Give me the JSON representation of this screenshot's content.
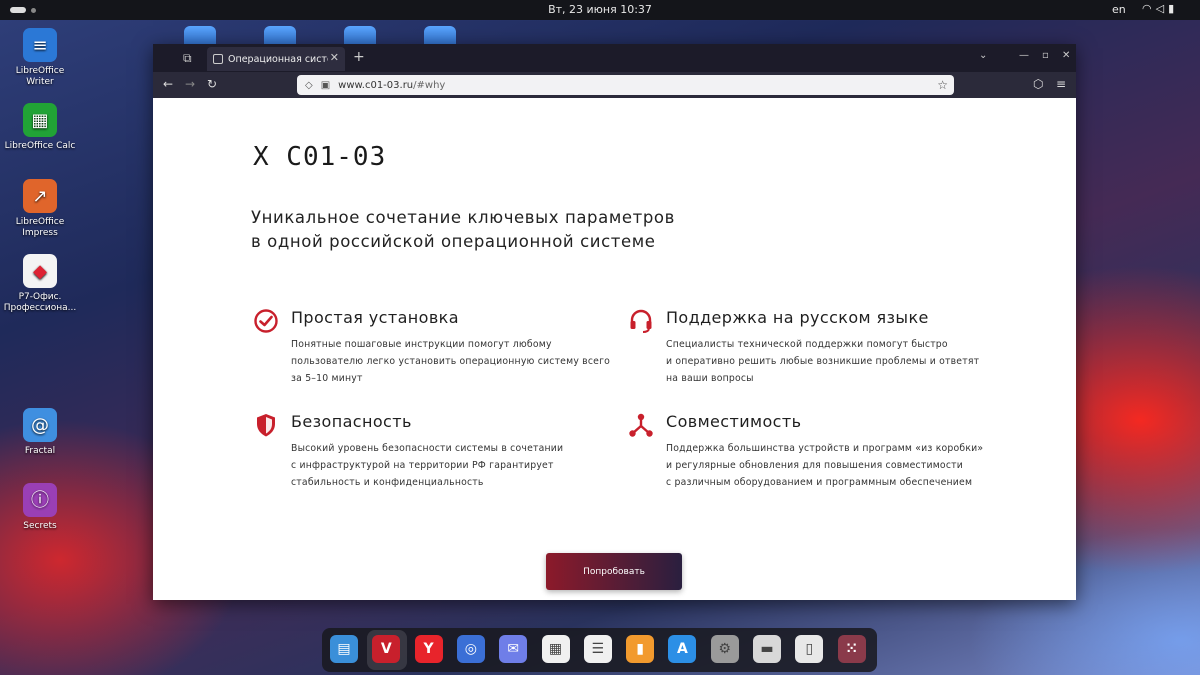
{
  "topbar": {
    "clock": "Вт, 23 июня  10:37",
    "language": "en"
  },
  "desktop": {
    "icons": [
      {
        "label_1": "LibreOffice",
        "label_2": "Writer",
        "icon": "writer-icon",
        "color": "#2b78d6"
      },
      {
        "label_1": "LibreOffice Calc",
        "label_2": "",
        "icon": "calc-icon",
        "color": "#21a336"
      },
      {
        "label_1": "LibreOffice",
        "label_2": "Impress",
        "icon": "impress-icon",
        "color": "#e0652b"
      },
      {
        "label_1": "Р7-Офис.",
        "label_2": "Профессиона...",
        "icon": "r7-office-icon",
        "color": "#f4f4f4"
      },
      {
        "label_1": "Fractal",
        "label_2": "",
        "icon": "fractal-icon",
        "color": "#3f8fe0"
      },
      {
        "label_1": "Secrets",
        "label_2": "",
        "icon": "secrets-icon",
        "color": "#9a3fb5"
      }
    ]
  },
  "browser": {
    "tab_title": "Операционная система",
    "url_host": "www.c01-03.ru",
    "url_path": "/#why"
  },
  "page": {
    "logo": "X C01-03",
    "tagline_line1": "Уникальное сочетание ключевых параметров",
    "tagline_line2": "в одной российской операционной системе",
    "accent_color": "#c8202c",
    "features": [
      {
        "title": "Простая установка",
        "icon": "check-circle-icon",
        "lines": [
          "Понятные пошаговые инструкции помогут любому",
          "пользователю легко установить операционную систему всего",
          "за 5–10 минут"
        ]
      },
      {
        "title": "Поддержка на русском языке",
        "icon": "headset-icon",
        "lines": [
          "Специалисты технической поддержки помогут быстро",
          "и оперативно решить любые возникшие проблемы и ответят",
          "на ваши вопросы"
        ]
      },
      {
        "title": "Безопасность",
        "icon": "shield-icon",
        "lines": [
          "Высокий уровень безопасности системы в сочетании",
          "с инфраструктурой на территории РФ гарантирует",
          "стабильность и конфиденциальность"
        ]
      },
      {
        "title": "Совместимость",
        "icon": "network-icon",
        "lines": [
          "Поддержка большинства устройств и программ «из коробки»",
          "и регулярные обновления для повышения совместимости",
          "с различным оборудованием и программным обеспечением"
        ]
      }
    ],
    "cta_label": "Попробовать"
  },
  "dock": {
    "items": [
      {
        "icon": "file-manager-icon",
        "glyph": "▤",
        "color": "#3a8fd9"
      },
      {
        "icon": "vivaldi-icon",
        "glyph": "V",
        "color": "#c8202c"
      },
      {
        "icon": "yandex-browser-icon",
        "glyph": "Y",
        "color": "#e8242b"
      },
      {
        "icon": "chromium-icon",
        "glyph": "◎",
        "color": "#3b6fd6"
      },
      {
        "icon": "mail-icon",
        "glyph": "✉",
        "color": "#6f7ee8"
      },
      {
        "icon": "calendar-icon",
        "glyph": "▦",
        "color": "#f0f0f0"
      },
      {
        "icon": "tasks-icon",
        "glyph": "☰",
        "color": "#f0f0f0"
      },
      {
        "icon": "office-icon",
        "glyph": "▮",
        "color": "#f29a2e"
      },
      {
        "icon": "software-store-icon",
        "glyph": "A",
        "color": "#2c8fe6"
      },
      {
        "icon": "settings-icon",
        "glyph": "⚙",
        "color": "#9a9a9a"
      },
      {
        "icon": "storage-icon",
        "glyph": "▬",
        "color": "#d8d8d8"
      },
      {
        "icon": "documents-icon",
        "glyph": "▯",
        "color": "#e8e8e8"
      },
      {
        "icon": "app-grid-icon",
        "glyph": "⁙",
        "color": "#8a3a4a"
      }
    ]
  }
}
